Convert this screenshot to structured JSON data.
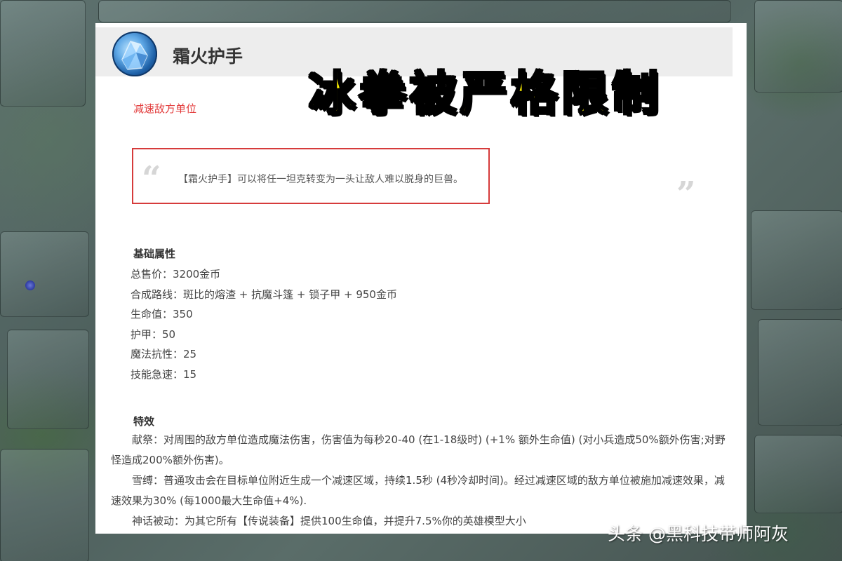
{
  "header": {
    "item_name": "霜火护手",
    "item_icon": "frost-gauntlet-icon"
  },
  "subtitle": "减速敌方单位",
  "overlay_title": "冰拳被严格限制",
  "quote": {
    "text": "【霜火护手】可以将任一坦克转变为一头让敌人难以脱身的巨兽。"
  },
  "base_stats": {
    "title": "基础属性",
    "lines": [
      "总售价：3200金币",
      "合成路线：斑比的熔渣 + 抗魔斗篷 + 锁子甲 + 950金币",
      "生命值：350",
      "护甲：50",
      "魔法抗性：25",
      "技能急速：15"
    ]
  },
  "effects": {
    "title": "特效",
    "paragraphs": [
      "献祭：对周围的敌方单位造成魔法伤害，伤害值为每秒20-40 (在1-18级时) (+1% 额外生命值) (对小兵造成50%额外伤害;对野怪造成200%额外伤害)。",
      "雪缚：普通攻击会在目标单位附近生成一个减速区域，持续1.5秒 (4秒冷却时间)。经过减速区域的敌方单位被施加减速效果，减速效果为30% (每1000最大生命值+4%).",
      "神话被动：为其它所有【传说装备】提供100生命值，并提升7.5%你的英雄模型大小"
    ]
  },
  "watermark": "头条 @黑科技带师阿灰",
  "colors": {
    "subtitle_red": "#e23a3a",
    "quote_border": "#d63b3b",
    "overlay_yellow": "#fff200"
  }
}
